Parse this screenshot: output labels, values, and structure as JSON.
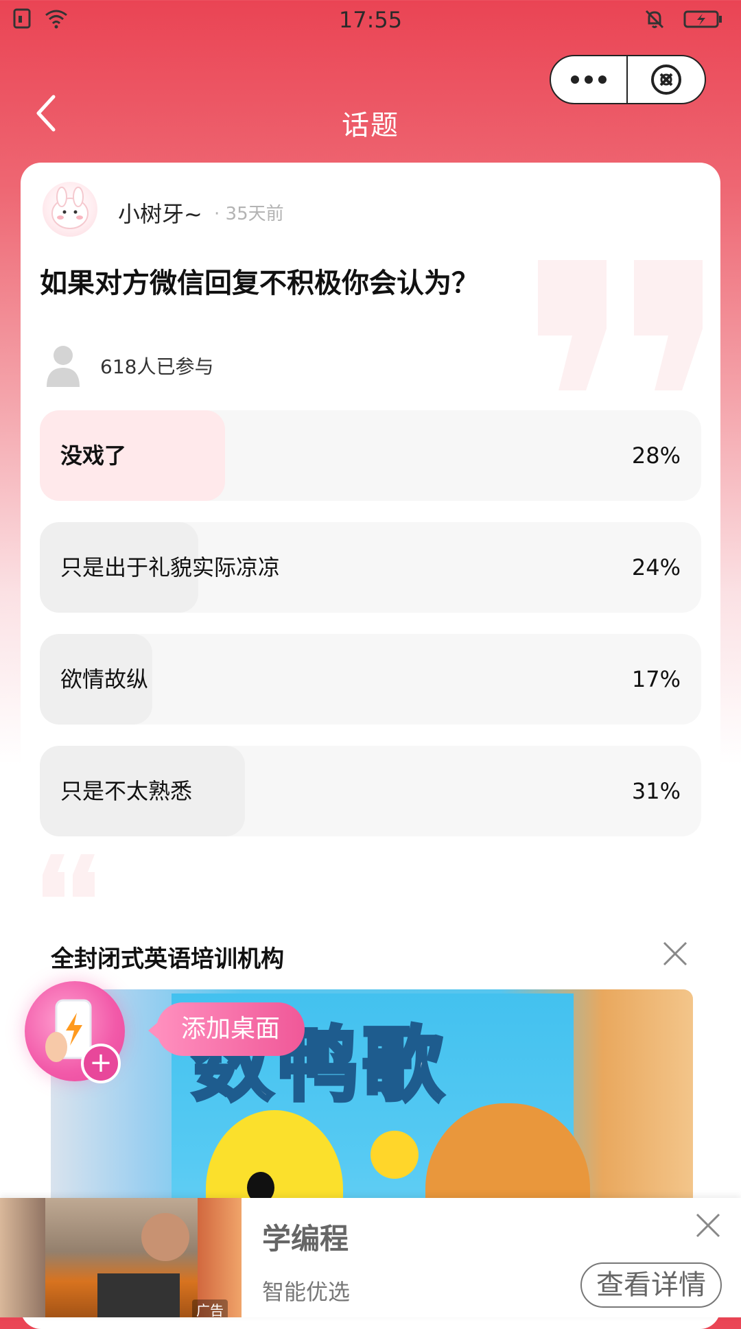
{
  "status_bar": {
    "time": "17:55"
  },
  "header": {
    "title": "话题"
  },
  "post": {
    "username": "小树牙~",
    "time_ago": "· 35天前",
    "question": "如果对方微信回复不积极你会认为？",
    "participants": "618人已参与",
    "options": [
      {
        "label": "没戏了",
        "percent_text": "28%",
        "percent": 28,
        "selected": true
      },
      {
        "label": "只是出于礼貌实际凉凉",
        "percent_text": "24%",
        "percent": 24,
        "selected": false
      },
      {
        "label": "欲情故纵",
        "percent_text": "17%",
        "percent": 17,
        "selected": false
      },
      {
        "label": "只是不太熟悉",
        "percent_text": "31%",
        "percent": 31,
        "selected": false
      }
    ]
  },
  "ad": {
    "title": "全封闭式英语培训机构",
    "image_headline": "数鸭歌"
  },
  "floating": {
    "add_desktop_label": "添加桌面"
  },
  "bottom_banner": {
    "title": "学编程",
    "subtitle": "智能优选",
    "button_label": "查看详情",
    "ad_tag": "广告"
  },
  "colors": {
    "accent": "#ea4454",
    "selected_fill": "#ffe9eb",
    "pink": "#f05898"
  }
}
